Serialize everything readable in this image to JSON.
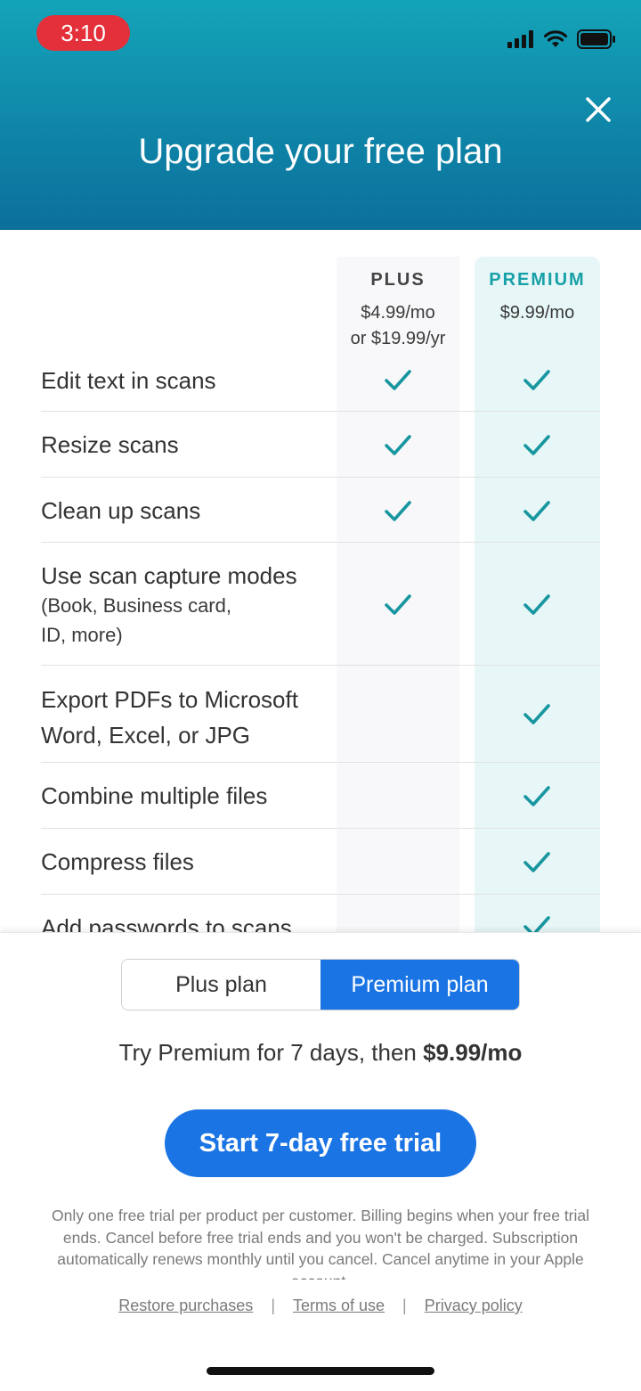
{
  "status_bar": {
    "time": "3:10",
    "time_pill_color": "#e4303a"
  },
  "header": {
    "title": "Upgrade your free plan",
    "close_icon": "close-icon",
    "gradient_top": "#14a4b9",
    "gradient_bottom": "#0c6f9c"
  },
  "plans": {
    "plus": {
      "name": "PLUS",
      "price_line1": "$4.99/mo",
      "price_line2": "or $19.99/yr"
    },
    "premium": {
      "name": "PREMIUM",
      "price_line1": "$9.99/mo",
      "accent": "#18a0a8"
    }
  },
  "features": [
    {
      "label": "Edit text in scans",
      "plus": true,
      "premium": true
    },
    {
      "label": "Resize scans",
      "plus": true,
      "premium": true
    },
    {
      "label": "Clean up scans",
      "plus": true,
      "premium": true
    },
    {
      "label": "Use scan capture modes",
      "sub_line1": "(Book, Business card,",
      "sub_line2": "ID, more)",
      "plus": true,
      "premium": true
    },
    {
      "label_line1": "Export PDFs to Microsoft",
      "label_line2": "Word, Excel, or JPG",
      "plus": false,
      "premium": true
    },
    {
      "label": "Combine multiple files",
      "plus": false,
      "premium": true
    },
    {
      "label": "Compress files",
      "plus": false,
      "premium": true
    },
    {
      "label": "Add passwords to scans",
      "plus": false,
      "premium": true
    }
  ],
  "plan_toggle": {
    "plus_label": "Plus plan",
    "premium_label": "Premium plan",
    "selected": "premium"
  },
  "trial": {
    "text_prefix": "Try Premium for 7 days, then ",
    "price": "$9.99/mo"
  },
  "cta": {
    "label": "Start 7-day free trial",
    "color": "#1b74e4"
  },
  "disclaimer": "Only one free trial per product per customer. Billing begins when your free trial ends. Cancel before free trial ends and you won't be charged. Subscription automatically renews monthly until you cancel. Cancel anytime in your Apple account.",
  "footer": {
    "restore": "Restore purchases",
    "terms": "Terms of use",
    "privacy": "Privacy policy",
    "separator": "|"
  },
  "check_color": "#1796a0"
}
